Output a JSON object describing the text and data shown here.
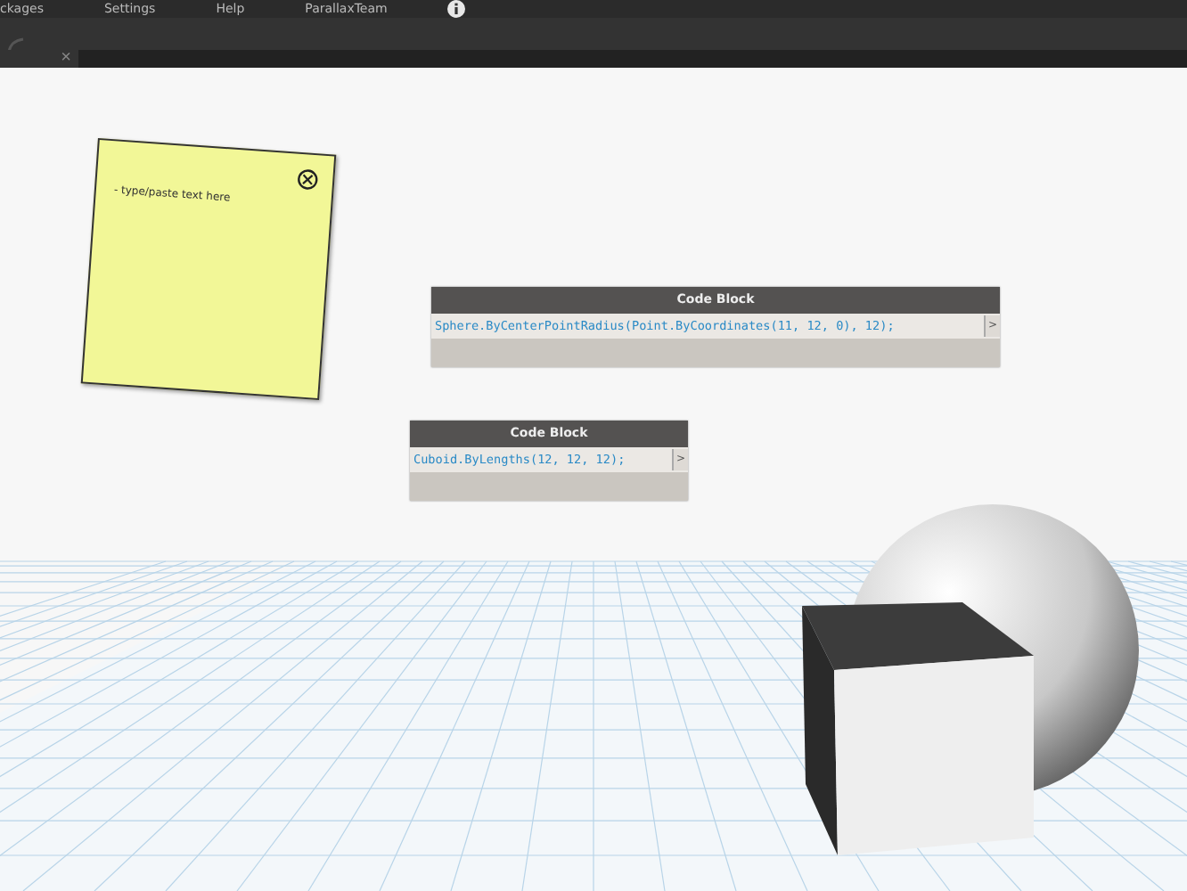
{
  "menu": [
    {
      "label": "ckages"
    },
    {
      "label": "Settings"
    },
    {
      "label": "Help"
    },
    {
      "label": "ParallaxTeam"
    }
  ],
  "tab": {
    "close": "×"
  },
  "note": {
    "text": "- type/paste text here"
  },
  "code_blocks": [
    {
      "title": "Code Block",
      "code": "Sphere.ByCenterPointRadius(Point.ByCoordinates(11, 12, 0), 12);",
      "port": ">"
    },
    {
      "title": "Code Block",
      "code": "Cuboid.ByLengths(12, 12, 12);",
      "port": ">"
    }
  ]
}
